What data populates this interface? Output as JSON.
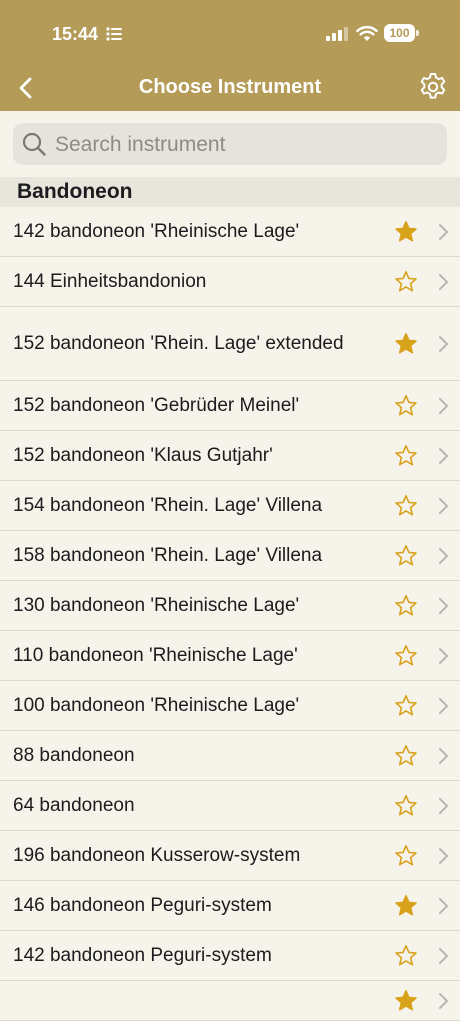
{
  "status_bar": {
    "time": "15:44",
    "battery": "100"
  },
  "nav": {
    "title": "Choose Instrument"
  },
  "search": {
    "placeholder": "Search instrument",
    "value": ""
  },
  "section": {
    "title": "Bandoneon"
  },
  "colors": {
    "header": "#b59b58",
    "star": "#d9a21b",
    "background": "#f6f3ea"
  },
  "items": [
    {
      "label": "142 bandoneon 'Rheinische Lage'",
      "favorite": true
    },
    {
      "label": "144 Einheitsbandonion",
      "favorite": false
    },
    {
      "label": "152 bandoneon 'Rhein. Lage' extended",
      "favorite": true
    },
    {
      "label": "152 bandoneon 'Gebrüder Meinel'",
      "favorite": false
    },
    {
      "label": "152 bandoneon 'Klaus Gutjahr'",
      "favorite": false
    },
    {
      "label": "154 bandoneon 'Rhein. Lage' Villena",
      "favorite": false
    },
    {
      "label": "158 bandoneon 'Rhein. Lage' Villena",
      "favorite": false
    },
    {
      "label": "130 bandoneon 'Rheinische Lage'",
      "favorite": false
    },
    {
      "label": "110 bandoneon 'Rheinische Lage'",
      "favorite": false
    },
    {
      "label": "100 bandoneon 'Rheinische Lage'",
      "favorite": false
    },
    {
      "label": "88 bandoneon",
      "favorite": false
    },
    {
      "label": "64 bandoneon",
      "favorite": false
    },
    {
      "label": "196 bandoneon Kusserow-system",
      "favorite": false
    },
    {
      "label": "146 bandoneon Peguri-system",
      "favorite": true
    },
    {
      "label": "142 bandoneon Peguri-system",
      "favorite": false
    },
    {
      "label": "",
      "favorite": true
    }
  ]
}
